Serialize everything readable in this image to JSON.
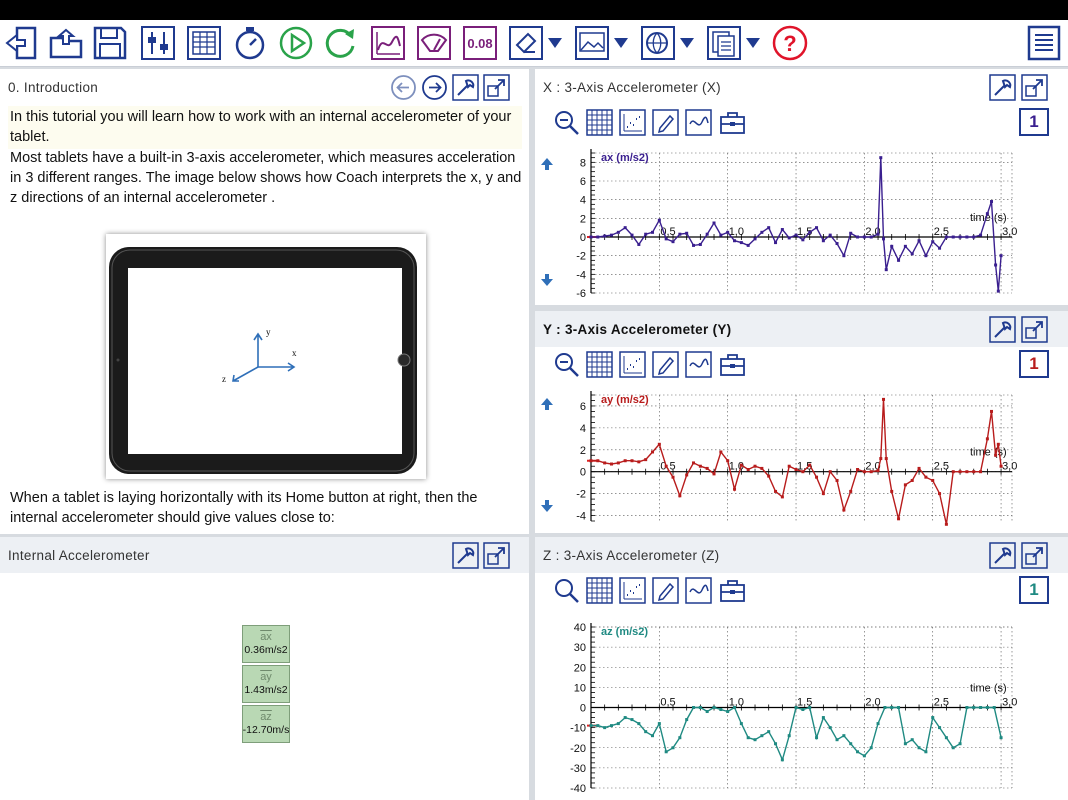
{
  "toolbar": {
    "icons": [
      "exit-icon",
      "open-file-icon",
      "save-icon",
      "settings-sliders-icon",
      "table-view-icon",
      "stopwatch-icon",
      "play-icon",
      "refresh-icon",
      "graph-icon",
      "meter-icon",
      "value-icon",
      "edit-icon",
      "image-icon",
      "web-icon",
      "copy-pages-icon",
      "help-icon",
      "notes-icon"
    ],
    "value_label": "0.08"
  },
  "intro": {
    "title": "0. Introduction",
    "paragraph1": "In this tutorial you will learn how to work with an internal accelerometer of your tablet.",
    "paragraph2": "Most tablets have a built-in 3-axis accelerometer, which measures acceleration in 3 different ranges. The image below shows how Coach interprets the x, y and z directions of an internal accelerometer .",
    "paragraph3": "When a tablet is laying horizontally with its Home button at right, then the internal accelerometer should give values close to:",
    "image_axes": {
      "x": "x",
      "y": "y",
      "z": "z"
    }
  },
  "meter": {
    "title": "Internal Accelerometer",
    "values": [
      {
        "name": "ax",
        "value": "0.36m/s2"
      },
      {
        "name": "ay",
        "value": "1.43m/s2"
      },
      {
        "name": "az",
        "value": "-12.70m/s"
      }
    ]
  },
  "graphs": {
    "x": {
      "title": "X : 3-Axis Accelerometer (X)",
      "badge": "1"
    },
    "y": {
      "title": "Y : 3-Axis Accelerometer (Y)",
      "badge": "1"
    },
    "z": {
      "title": "Z : 3-Axis Accelerometer (Z)",
      "badge": "1"
    }
  },
  "colors": {
    "x_series": "#3a1f8f",
    "y_series": "#b81c1c",
    "z_series": "#1f8a82",
    "accent": "#1f3a8f",
    "help": "#e0142a",
    "purple": "#7a1f7a",
    "green": "#2aa34a"
  },
  "chart_data": [
    {
      "type": "line",
      "ylabel": "ax (m/s2)",
      "xlabel": "time (s)",
      "ylim": [
        -6,
        9
      ],
      "xlim": [
        0,
        3.08
      ],
      "yticks": [
        8,
        6,
        4,
        2,
        0,
        -2,
        -4,
        -6
      ],
      "xticks": [
        0.5,
        1.0,
        1.5,
        2.0,
        2.5,
        3.0
      ],
      "xtick_labels": [
        "0,5",
        "1,0",
        "1,5",
        "2,0",
        "2,5",
        "3,0"
      ],
      "ytick_labels": [
        "8",
        "6",
        "4",
        "2",
        "0",
        "-2",
        "-4",
        "-6"
      ],
      "grid": true,
      "series": [
        {
          "x": [
            0,
            0.05,
            0.1,
            0.15,
            0.2,
            0.25,
            0.3,
            0.35,
            0.4,
            0.45,
            0.5,
            0.55,
            0.6,
            0.65,
            0.7,
            0.75,
            0.8,
            0.85,
            0.9,
            0.95,
            1.0,
            1.05,
            1.1,
            1.15,
            1.2,
            1.25,
            1.3,
            1.35,
            1.4,
            1.45,
            1.5,
            1.55,
            1.6,
            1.65,
            1.7,
            1.75,
            1.8,
            1.85,
            1.9,
            1.95,
            2.0,
            2.05,
            2.1,
            2.12,
            2.14,
            2.16,
            2.2,
            2.25,
            2.3,
            2.35,
            2.4,
            2.45,
            2.5,
            2.55,
            2.6,
            2.65,
            2.7,
            2.75,
            2.8,
            2.85,
            2.9,
            2.93,
            2.96,
            2.98,
            3.0
          ],
          "y": [
            0,
            0,
            0.1,
            0.2,
            0.5,
            1.0,
            0.2,
            -0.8,
            0.3,
            0.5,
            1.8,
            -0.2,
            -0.5,
            0.3,
            0.4,
            -0.9,
            -0.8,
            0.3,
            1.5,
            0.2,
            0.5,
            -0.4,
            -0.6,
            -0.9,
            -0.2,
            0.5,
            1.0,
            -0.6,
            0.8,
            -0.1,
            0.2,
            -0.3,
            0.5,
            1.0,
            -0.4,
            0.2,
            -0.7,
            -2.0,
            0.4,
            0,
            0,
            0,
            0.3,
            8.5,
            -0.2,
            -3.5,
            -1.0,
            -2.5,
            -1.0,
            -1.8,
            -0.4,
            -2.0,
            -0.5,
            -1.2,
            0,
            0,
            0,
            0,
            0,
            0.2,
            2.5,
            3.8,
            -3.0,
            -5.8,
            -2.0
          ]
        }
      ]
    },
    {
      "type": "line",
      "ylabel": "ay (m/s2)",
      "xlabel": "time (s)",
      "ylim": [
        -4.5,
        7
      ],
      "xlim": [
        0,
        3.08
      ],
      "yticks": [
        6,
        4,
        2,
        0,
        -2,
        -4
      ],
      "xticks": [
        0.5,
        1.0,
        1.5,
        2.0,
        2.5,
        3.0
      ],
      "xtick_labels": [
        "0,5",
        "1,0",
        "1,5",
        "2,0",
        "2,5",
        "3,0"
      ],
      "ytick_labels": [
        "6",
        "4",
        "2",
        "0",
        "-2",
        "-4"
      ],
      "grid": true,
      "series": [
        {
          "x": [
            0,
            0.05,
            0.1,
            0.15,
            0.2,
            0.25,
            0.3,
            0.35,
            0.4,
            0.45,
            0.5,
            0.55,
            0.6,
            0.65,
            0.7,
            0.75,
            0.8,
            0.85,
            0.9,
            0.95,
            1.0,
            1.05,
            1.1,
            1.15,
            1.2,
            1.25,
            1.3,
            1.35,
            1.4,
            1.45,
            1.5,
            1.55,
            1.6,
            1.65,
            1.7,
            1.75,
            1.8,
            1.85,
            1.9,
            1.95,
            2.0,
            2.05,
            2.1,
            2.12,
            2.14,
            2.16,
            2.2,
            2.25,
            2.3,
            2.35,
            2.4,
            2.45,
            2.5,
            2.55,
            2.6,
            2.65,
            2.7,
            2.75,
            2.8,
            2.85,
            2.9,
            2.93,
            2.96,
            2.98,
            3.0
          ],
          "y": [
            1.0,
            1.0,
            0.8,
            0.7,
            0.8,
            1.0,
            1.0,
            0.9,
            1.1,
            1.8,
            2.5,
            0.5,
            -0.5,
            -2.2,
            -0.3,
            0.8,
            0.5,
            0.3,
            -0.2,
            1.8,
            1.0,
            -1.6,
            0.6,
            0.2,
            0.5,
            0.3,
            -0.4,
            -1.8,
            -2.3,
            0.5,
            0.2,
            0,
            0.6,
            -0.5,
            -2.0,
            0,
            -0.8,
            -3.5,
            -1.8,
            0.2,
            0,
            0,
            0.1,
            1.2,
            6.6,
            1.2,
            -1.8,
            -4.3,
            -1.2,
            -0.8,
            0.3,
            -0.5,
            -0.8,
            -2.0,
            -4.8,
            0,
            0,
            0,
            0,
            0,
            3.0,
            5.5,
            1.5,
            2.5,
            0.5
          ]
        }
      ]
    },
    {
      "type": "line",
      "ylabel": "az (m/s2)",
      "xlabel": "time (s)",
      "ylim": [
        -40,
        40
      ],
      "xlim": [
        0,
        3.08
      ],
      "yticks": [
        40,
        30,
        20,
        10,
        0,
        -10,
        -20,
        -30,
        -40
      ],
      "xticks": [
        0.5,
        1.0,
        1.5,
        2.0,
        2.5,
        3.0
      ],
      "xtick_labels": [
        "0,5",
        "1,0",
        "1,5",
        "2,0",
        "2,5",
        "3,0"
      ],
      "ytick_labels": [
        "40",
        "30",
        "20",
        "10",
        "0",
        "-10",
        "-20",
        "-30",
        "-40"
      ],
      "grid": true,
      "series": [
        {
          "x": [
            0,
            0.05,
            0.1,
            0.15,
            0.2,
            0.25,
            0.3,
            0.35,
            0.4,
            0.45,
            0.5,
            0.55,
            0.6,
            0.65,
            0.7,
            0.75,
            0.8,
            0.85,
            0.9,
            0.95,
            1.0,
            1.05,
            1.1,
            1.15,
            1.2,
            1.25,
            1.3,
            1.35,
            1.4,
            1.45,
            1.5,
            1.55,
            1.6,
            1.65,
            1.7,
            1.75,
            1.8,
            1.85,
            1.9,
            1.95,
            2.0,
            2.05,
            2.1,
            2.15,
            2.2,
            2.25,
            2.3,
            2.35,
            2.4,
            2.45,
            2.5,
            2.55,
            2.6,
            2.65,
            2.7,
            2.75,
            2.8,
            2.85,
            2.9,
            2.95,
            3.0
          ],
          "y": [
            -9,
            -9,
            -10,
            -9,
            -8,
            -5,
            -6,
            -8,
            -12,
            -14,
            -8,
            -22,
            -20,
            -15,
            -6,
            0,
            0,
            -2,
            0,
            -1,
            -2,
            0,
            -8,
            -15,
            -16,
            -14,
            -12,
            -18,
            -26,
            -14,
            0,
            -1,
            0,
            -15,
            -5,
            -10,
            -16,
            -14,
            -18,
            -22,
            -24,
            -20,
            -8,
            0,
            0,
            0,
            -18,
            -16,
            -20,
            -22,
            -5,
            -10,
            -15,
            -20,
            -18,
            0,
            0,
            0,
            0,
            0,
            -15
          ]
        }
      ]
    }
  ]
}
